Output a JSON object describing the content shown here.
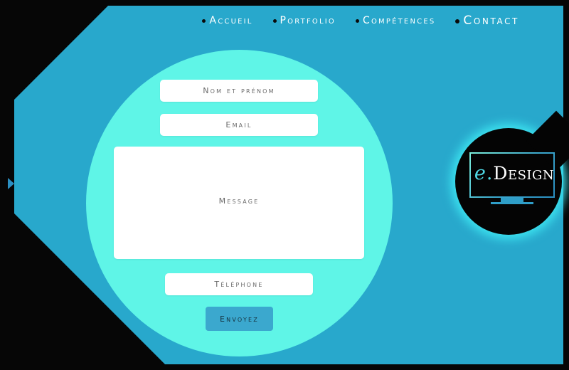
{
  "site": {
    "active_page": "Contact"
  },
  "nav": {
    "items": [
      {
        "label": "Accueil",
        "icon": "bullet-dot-icon",
        "active": false
      },
      {
        "label": "Portfolio",
        "icon": "bullet-dot-icon",
        "active": false
      },
      {
        "label": "Compétences",
        "icon": "bullet-dot-icon",
        "active": false
      },
      {
        "label": "Contact",
        "icon": "bullet-dot-icon",
        "active": true
      }
    ]
  },
  "form": {
    "name": {
      "placeholder": "Nom et prénom",
      "value": ""
    },
    "email": {
      "placeholder": "Email",
      "value": ""
    },
    "message": {
      "placeholder": "Message",
      "value": ""
    },
    "phone": {
      "placeholder": "Téléphone",
      "value": ""
    },
    "submit_label": "Envoyez"
  },
  "logo": {
    "mark": "e",
    "separator": ".",
    "word": "Design",
    "icon": "monitor-icon"
  },
  "decor": {
    "left_arrow_icon": "chevron-right-icon"
  },
  "colors": {
    "background": "#060606",
    "panel_blue": "#28a8cc",
    "circle_mint": "#5ff5e7",
    "button_blue": "#3ba8ce",
    "logo_glow": "#3ce4f0",
    "field_white": "#ffffff",
    "placeholder_gray": "#6a6a6a",
    "nav_text": "#ffffff"
  }
}
